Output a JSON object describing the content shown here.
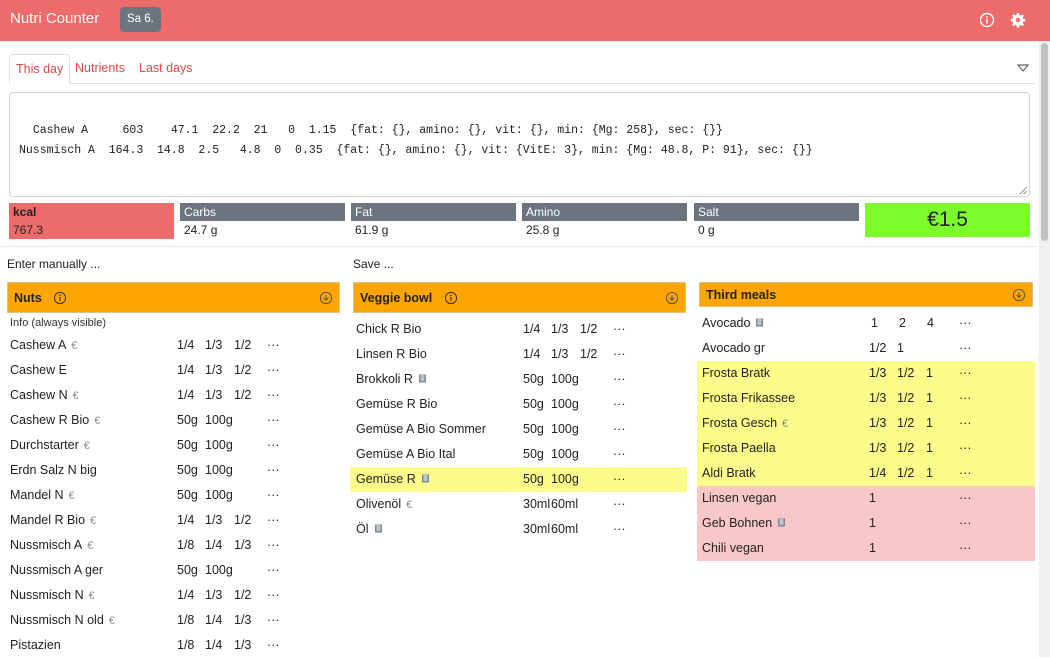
{
  "header": {
    "title": "Nutri Counter",
    "date": "Sa 6.",
    "info_icon": "info-icon",
    "settings_icon": "gear-icon"
  },
  "tabs": [
    {
      "label": "This day",
      "active": true
    },
    {
      "label": "Nutrients"
    },
    {
      "label": "Last days"
    }
  ],
  "food_text": "Cashew A     603    47.1  22.2  21   0  1.15  {fat: {}, amino: {}, vit: {}, min: {Mg: 258}, sec: {}}\nNussmisch A  164.3  14.8  2.5   4.8  0  0.35  {fat: {}, amino: {}, vit: {VitE: 3}, min: {Mg: 48.8, P: 91}, sec: {}}",
  "summary": {
    "kcal": {
      "label": "kcal",
      "value": "767.3"
    },
    "carbs": {
      "label": "Carbs",
      "value": "24.7 g"
    },
    "fat": {
      "label": "Fat",
      "value": "61.9 g"
    },
    "amino": {
      "label": "Amino",
      "value": "25.8 g"
    },
    "salt": {
      "label": "Salt",
      "value": "0 g"
    },
    "price": "€1.5"
  },
  "links": {
    "enter_manually": "Enter manually ...",
    "save": "Save ..."
  },
  "colors": {
    "header": "#ed6b6b",
    "panel_head": "#ffa500",
    "price": "#7cfc2a",
    "highlight_yellow": "#fcfc8a",
    "highlight_pink": "#f8c8c8"
  },
  "panels": {
    "nuts": {
      "title": "Nuts",
      "info": "Info (always visible)",
      "rows": [
        {
          "name": "Cashew A",
          "euro": "€",
          "opts": [
            "1/4",
            "1/3",
            "1/2"
          ],
          "more": "···"
        },
        {
          "name": "Cashew E",
          "opts": [
            "1/4",
            "1/3",
            "1/2"
          ],
          "more": "···"
        },
        {
          "name": "Cashew N",
          "euro": "€",
          "opts": [
            "1/4",
            "1/3",
            "1/2"
          ],
          "more": "···"
        },
        {
          "name": "Cashew R Bio",
          "euro": "€",
          "opts": [
            "50g",
            "100g"
          ],
          "more": "···"
        },
        {
          "name": "Durchstarter",
          "euro": "€",
          "opts": [
            "50g",
            "100g"
          ],
          "more": "···"
        },
        {
          "name": "Erdn Salz N big",
          "opts": [
            "50g",
            "100g"
          ],
          "more": "···"
        },
        {
          "name": "Mandel N",
          "euro": "€",
          "opts": [
            "50g",
            "100g"
          ],
          "more": "···"
        },
        {
          "name": "Mandel R Bio",
          "euro": "€",
          "opts": [
            "1/4",
            "1/3",
            "1/2"
          ],
          "more": "···"
        },
        {
          "name": "Nussmisch A",
          "euro": "€",
          "opts": [
            "1/8",
            "1/4",
            "1/3"
          ],
          "more": "···"
        },
        {
          "name": "Nussmisch A ger",
          "opts": [
            "50g",
            "100g"
          ],
          "more": "···"
        },
        {
          "name": "Nussmisch N",
          "euro": "€",
          "opts": [
            "1/4",
            "1/3",
            "1/2"
          ],
          "more": "···"
        },
        {
          "name": "Nussmisch N old",
          "euro": "€",
          "opts": [
            "1/8",
            "1/4",
            "1/3"
          ],
          "more": "···"
        },
        {
          "name": "Pistazien",
          "opts": [
            "1/8",
            "1/4",
            "1/3"
          ],
          "more": "···"
        }
      ]
    },
    "veggie": {
      "title": "Veggie bowl",
      "rows": [
        {
          "name": "Chick R Bio",
          "opts": [
            "1/4",
            "1/3",
            "1/2"
          ],
          "more": "···"
        },
        {
          "name": "Linsen R Bio",
          "opts": [
            "1/4",
            "1/3",
            "1/2"
          ],
          "more": "···"
        },
        {
          "name": "Brokkoli R",
          "veg": true,
          "opts": [
            "50g",
            "100g"
          ],
          "more": "···"
        },
        {
          "name": "Gemüse R Bio",
          "opts": [
            "50g",
            "100g"
          ],
          "more": "···"
        },
        {
          "name": "Gemüse A Bio Sommer",
          "opts": [
            "50g",
            "100g"
          ],
          "more": "···"
        },
        {
          "name": "Gemüse A Bio Ital",
          "opts": [
            "50g",
            "100g"
          ],
          "more": "···"
        },
        {
          "name": "Gemüse R",
          "veg": true,
          "opts": [
            "50g",
            "100g"
          ],
          "more": "···",
          "hl": "yellow"
        },
        {
          "name": "Olivenöl",
          "euro": "€",
          "opts": [
            "30ml",
            "60ml"
          ],
          "more": "···"
        },
        {
          "name": "Öl",
          "veg": true,
          "opts": [
            "30ml",
            "60ml"
          ],
          "more": "···"
        }
      ]
    },
    "third": {
      "title": "Third meals",
      "rows": [
        {
          "name": "Avocado",
          "veg": true,
          "opts": [
            "1",
            "2",
            "4"
          ],
          "more": "···"
        },
        {
          "name": "Avocado gr",
          "opts": [
            "1/2",
            "1"
          ],
          "more": "···"
        },
        {
          "name": "Frosta Bratk",
          "opts": [
            "1/3",
            "1/2",
            "1"
          ],
          "more": "···",
          "hl": "yellow"
        },
        {
          "name": "Frosta Frikassee",
          "opts": [
            "1/3",
            "1/2",
            "1"
          ],
          "more": "···",
          "hl": "yellow"
        },
        {
          "name": "Frosta Gesch",
          "euro": "€",
          "opts": [
            "1/3",
            "1/2",
            "1"
          ],
          "more": "···",
          "hl": "yellow"
        },
        {
          "name": "Frosta Paella",
          "opts": [
            "1/3",
            "1/2",
            "1"
          ],
          "more": "···",
          "hl": "yellow"
        },
        {
          "name": "Aldi Bratk",
          "opts": [
            "1/4",
            "1/2",
            "1"
          ],
          "more": "···",
          "hl": "yellow"
        },
        {
          "name": "Linsen vegan",
          "opts": [
            "1"
          ],
          "more": "···",
          "hl": "pink"
        },
        {
          "name": "Geb Bohnen",
          "veg": true,
          "opts": [
            "1"
          ],
          "more": "···",
          "hl": "pink"
        },
        {
          "name": "Chili vegan",
          "opts": [
            "1"
          ],
          "more": "···",
          "hl": "pink"
        }
      ]
    }
  }
}
